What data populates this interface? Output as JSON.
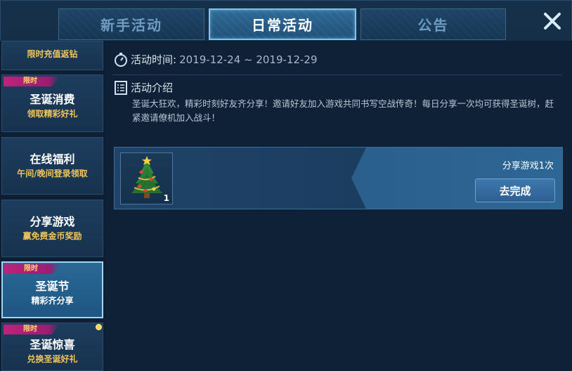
{
  "tabs": [
    {
      "label": "新手活动",
      "active": false
    },
    {
      "label": "日常活动",
      "active": true
    },
    {
      "label": "公告",
      "active": false
    }
  ],
  "close_icon": "close-icon",
  "sidebar": {
    "items": [
      {
        "title": "限时充值返钻",
        "subtitle": "",
        "badge": ""
      },
      {
        "title": "圣诞消费",
        "subtitle": "领取精彩好礼",
        "badge": "限时"
      },
      {
        "title": "在线福利",
        "subtitle": "午间/晚间登录领取",
        "badge": ""
      },
      {
        "title": "分享游戏",
        "subtitle": "赢免费金币奖励",
        "badge": ""
      },
      {
        "title": "圣诞节",
        "subtitle": "精彩齐分享",
        "badge": "限时",
        "active": true
      },
      {
        "title": "圣诞惊喜",
        "subtitle": "兑换圣诞好礼",
        "badge": "限时",
        "notify_dot": true
      }
    ]
  },
  "main": {
    "time_label": "活动时间:",
    "time_value": "2019-12-24 ~ 2019-12-29",
    "intro_label": "活动介绍",
    "intro_text": "圣诞大狂欢，精彩时刻好友齐分享！邀请好友加入游戏共同书写空战传奇！每日分享一次均可获得圣诞树，赶紧邀请僚机加入战斗！",
    "task": {
      "item_icon": "christmas-tree-icon",
      "item_count": "1",
      "name": "分享游戏1次",
      "button": "去完成"
    }
  },
  "colors": {
    "active_tab_border": "#7fc4ea",
    "badge": "#c0227a",
    "subtitle_gold": "#f0c65a",
    "notify_dot": "#f7d552"
  }
}
